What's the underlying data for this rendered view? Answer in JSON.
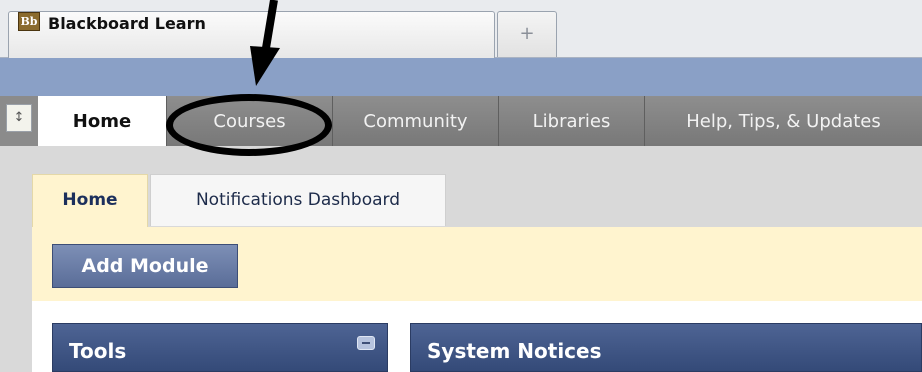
{
  "browser": {
    "logo_text": "Bb",
    "tab_title": "Blackboard Learn",
    "new_tab_symbol": "+"
  },
  "nav": {
    "collapse_icon": "↕",
    "tabs": [
      {
        "label": "Home",
        "active": true
      },
      {
        "label": "Courses",
        "active": false
      },
      {
        "label": "Community",
        "active": false
      },
      {
        "label": "Libraries",
        "active": false
      },
      {
        "label": "Help, Tips, & Updates",
        "active": false
      }
    ]
  },
  "subtabs": [
    {
      "label": "Home",
      "active": true
    },
    {
      "label": "Notifications Dashboard",
      "active": false
    }
  ],
  "actions": {
    "add_module": "Add Module"
  },
  "modules": [
    {
      "title": "Tools"
    },
    {
      "title": "System Notices"
    }
  ],
  "icons": {
    "collapse": "collapse-icon",
    "module_collapse": "minimize-icon",
    "annotation_arrow": "arrow-icon",
    "annotation_circle": "circle-annotation"
  }
}
